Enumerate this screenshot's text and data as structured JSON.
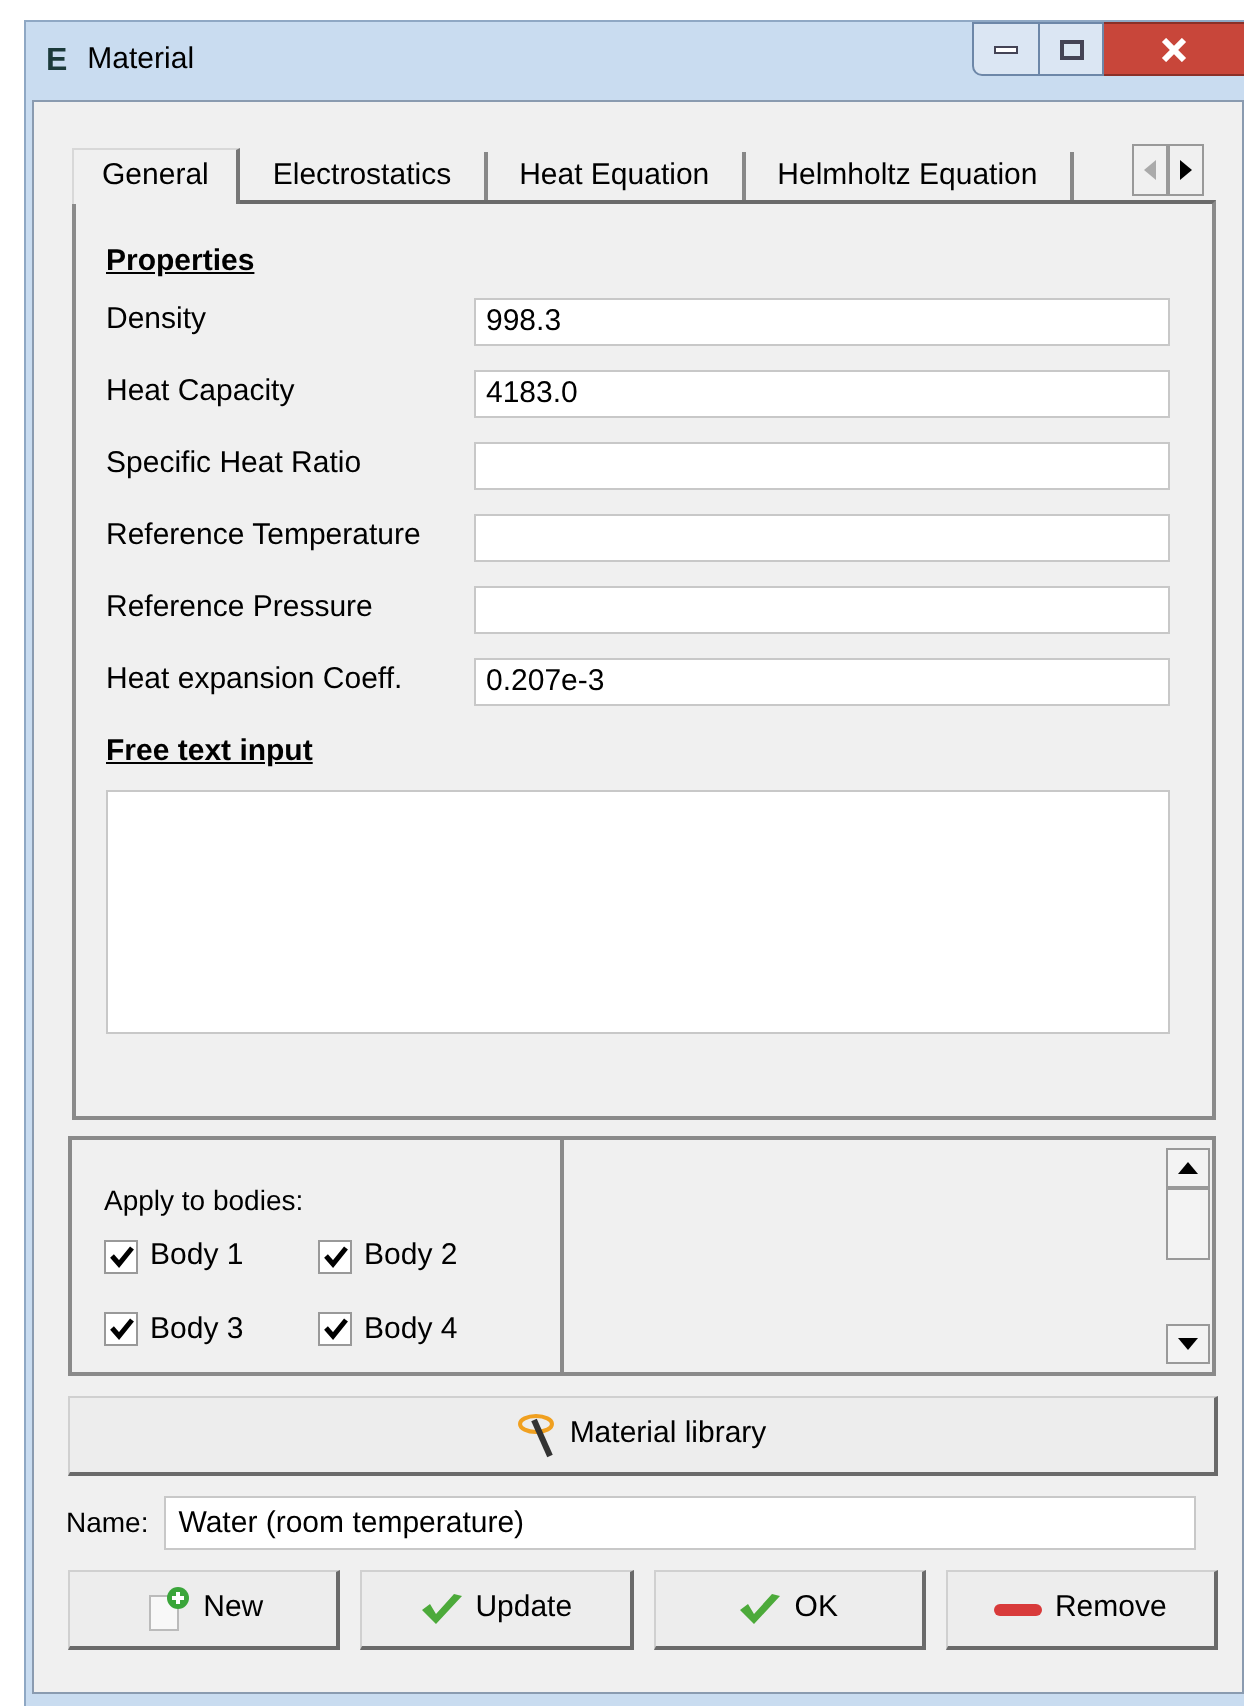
{
  "window": {
    "icon_letter": "E",
    "title": "Material"
  },
  "tabs": [
    {
      "label": "General",
      "selected": true
    },
    {
      "label": "Electrostatics",
      "selected": false
    },
    {
      "label": "Heat Equation",
      "selected": false
    },
    {
      "label": "Helmholtz Equation",
      "selected": false
    }
  ],
  "properties": {
    "heading": "Properties",
    "fields": [
      {
        "label": "Density",
        "value": "998.3"
      },
      {
        "label": "Heat Capacity",
        "value": "4183.0"
      },
      {
        "label": "Specific Heat Ratio"
      },
      {
        "label": "Reference Temperature"
      },
      {
        "label": "Reference Pressure"
      },
      {
        "label": "Heat expansion Coeff.",
        "value": "0.207e-3"
      }
    ]
  },
  "free_text": {
    "heading": "Free text input"
  },
  "bodies": {
    "label": "Apply to bodies:",
    "items": [
      {
        "label": "Body 1",
        "checked": true
      },
      {
        "label": "Body 2",
        "checked": true
      },
      {
        "label": "Body 3",
        "checked": true
      },
      {
        "label": "Body 4",
        "checked": true
      }
    ]
  },
  "library_button": "Material library",
  "name": {
    "label": "Name:",
    "value": "Water (room temperature)"
  },
  "buttons": [
    {
      "kind": "new",
      "label": "New"
    },
    {
      "kind": "update",
      "label": "Update"
    },
    {
      "kind": "ok",
      "label": "OK"
    },
    {
      "kind": "remove",
      "label": "Remove"
    }
  ]
}
